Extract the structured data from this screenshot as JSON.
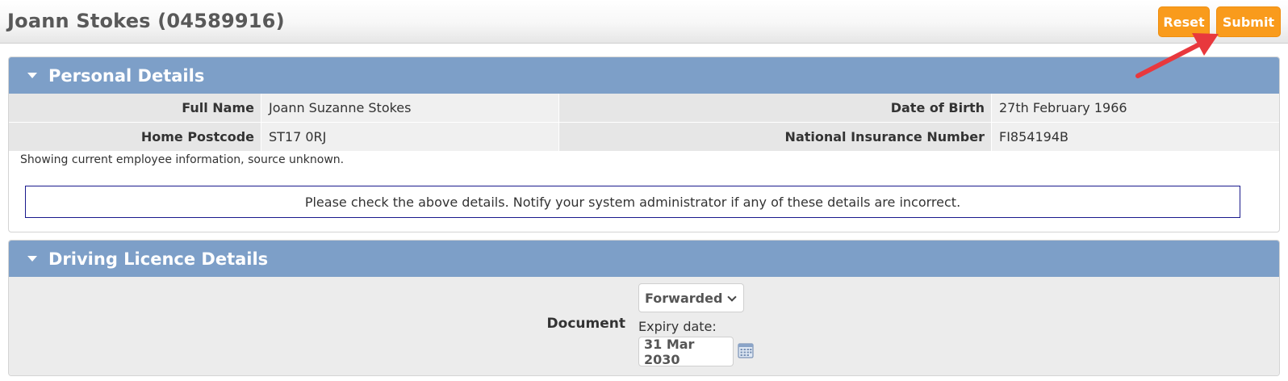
{
  "header": {
    "title": "Joann Stokes (04589916)",
    "reset_label": "Reset",
    "submit_label": "Submit"
  },
  "personal": {
    "title": "Personal Details",
    "full_name_label": "Full Name",
    "full_name": "Joann Suzanne Stokes",
    "dob_label": "Date of Birth",
    "dob": "27th February 1966",
    "postcode_label": "Home Postcode",
    "postcode": "ST17 0RJ",
    "ni_label": "National Insurance Number",
    "ni": "FI854194B",
    "source_note": "Showing current employee information, source unknown.",
    "notice": "Please check the above details. Notify your system administrator if any of these details are incorrect."
  },
  "driving": {
    "title": "Driving Licence Details",
    "document_label": "Document",
    "document_value": "Forwarded",
    "expiry_label": "Expiry date:",
    "expiry_value": "31 Mar 2030"
  },
  "colors": {
    "accent_orange": "#f99b1c",
    "panel_header_blue": "#7d9fc8",
    "annotation_red": "#e8383d"
  },
  "icons": [
    "caret-down-icon",
    "chevron-down-icon",
    "calendar-icon",
    "annotation-arrow"
  ]
}
